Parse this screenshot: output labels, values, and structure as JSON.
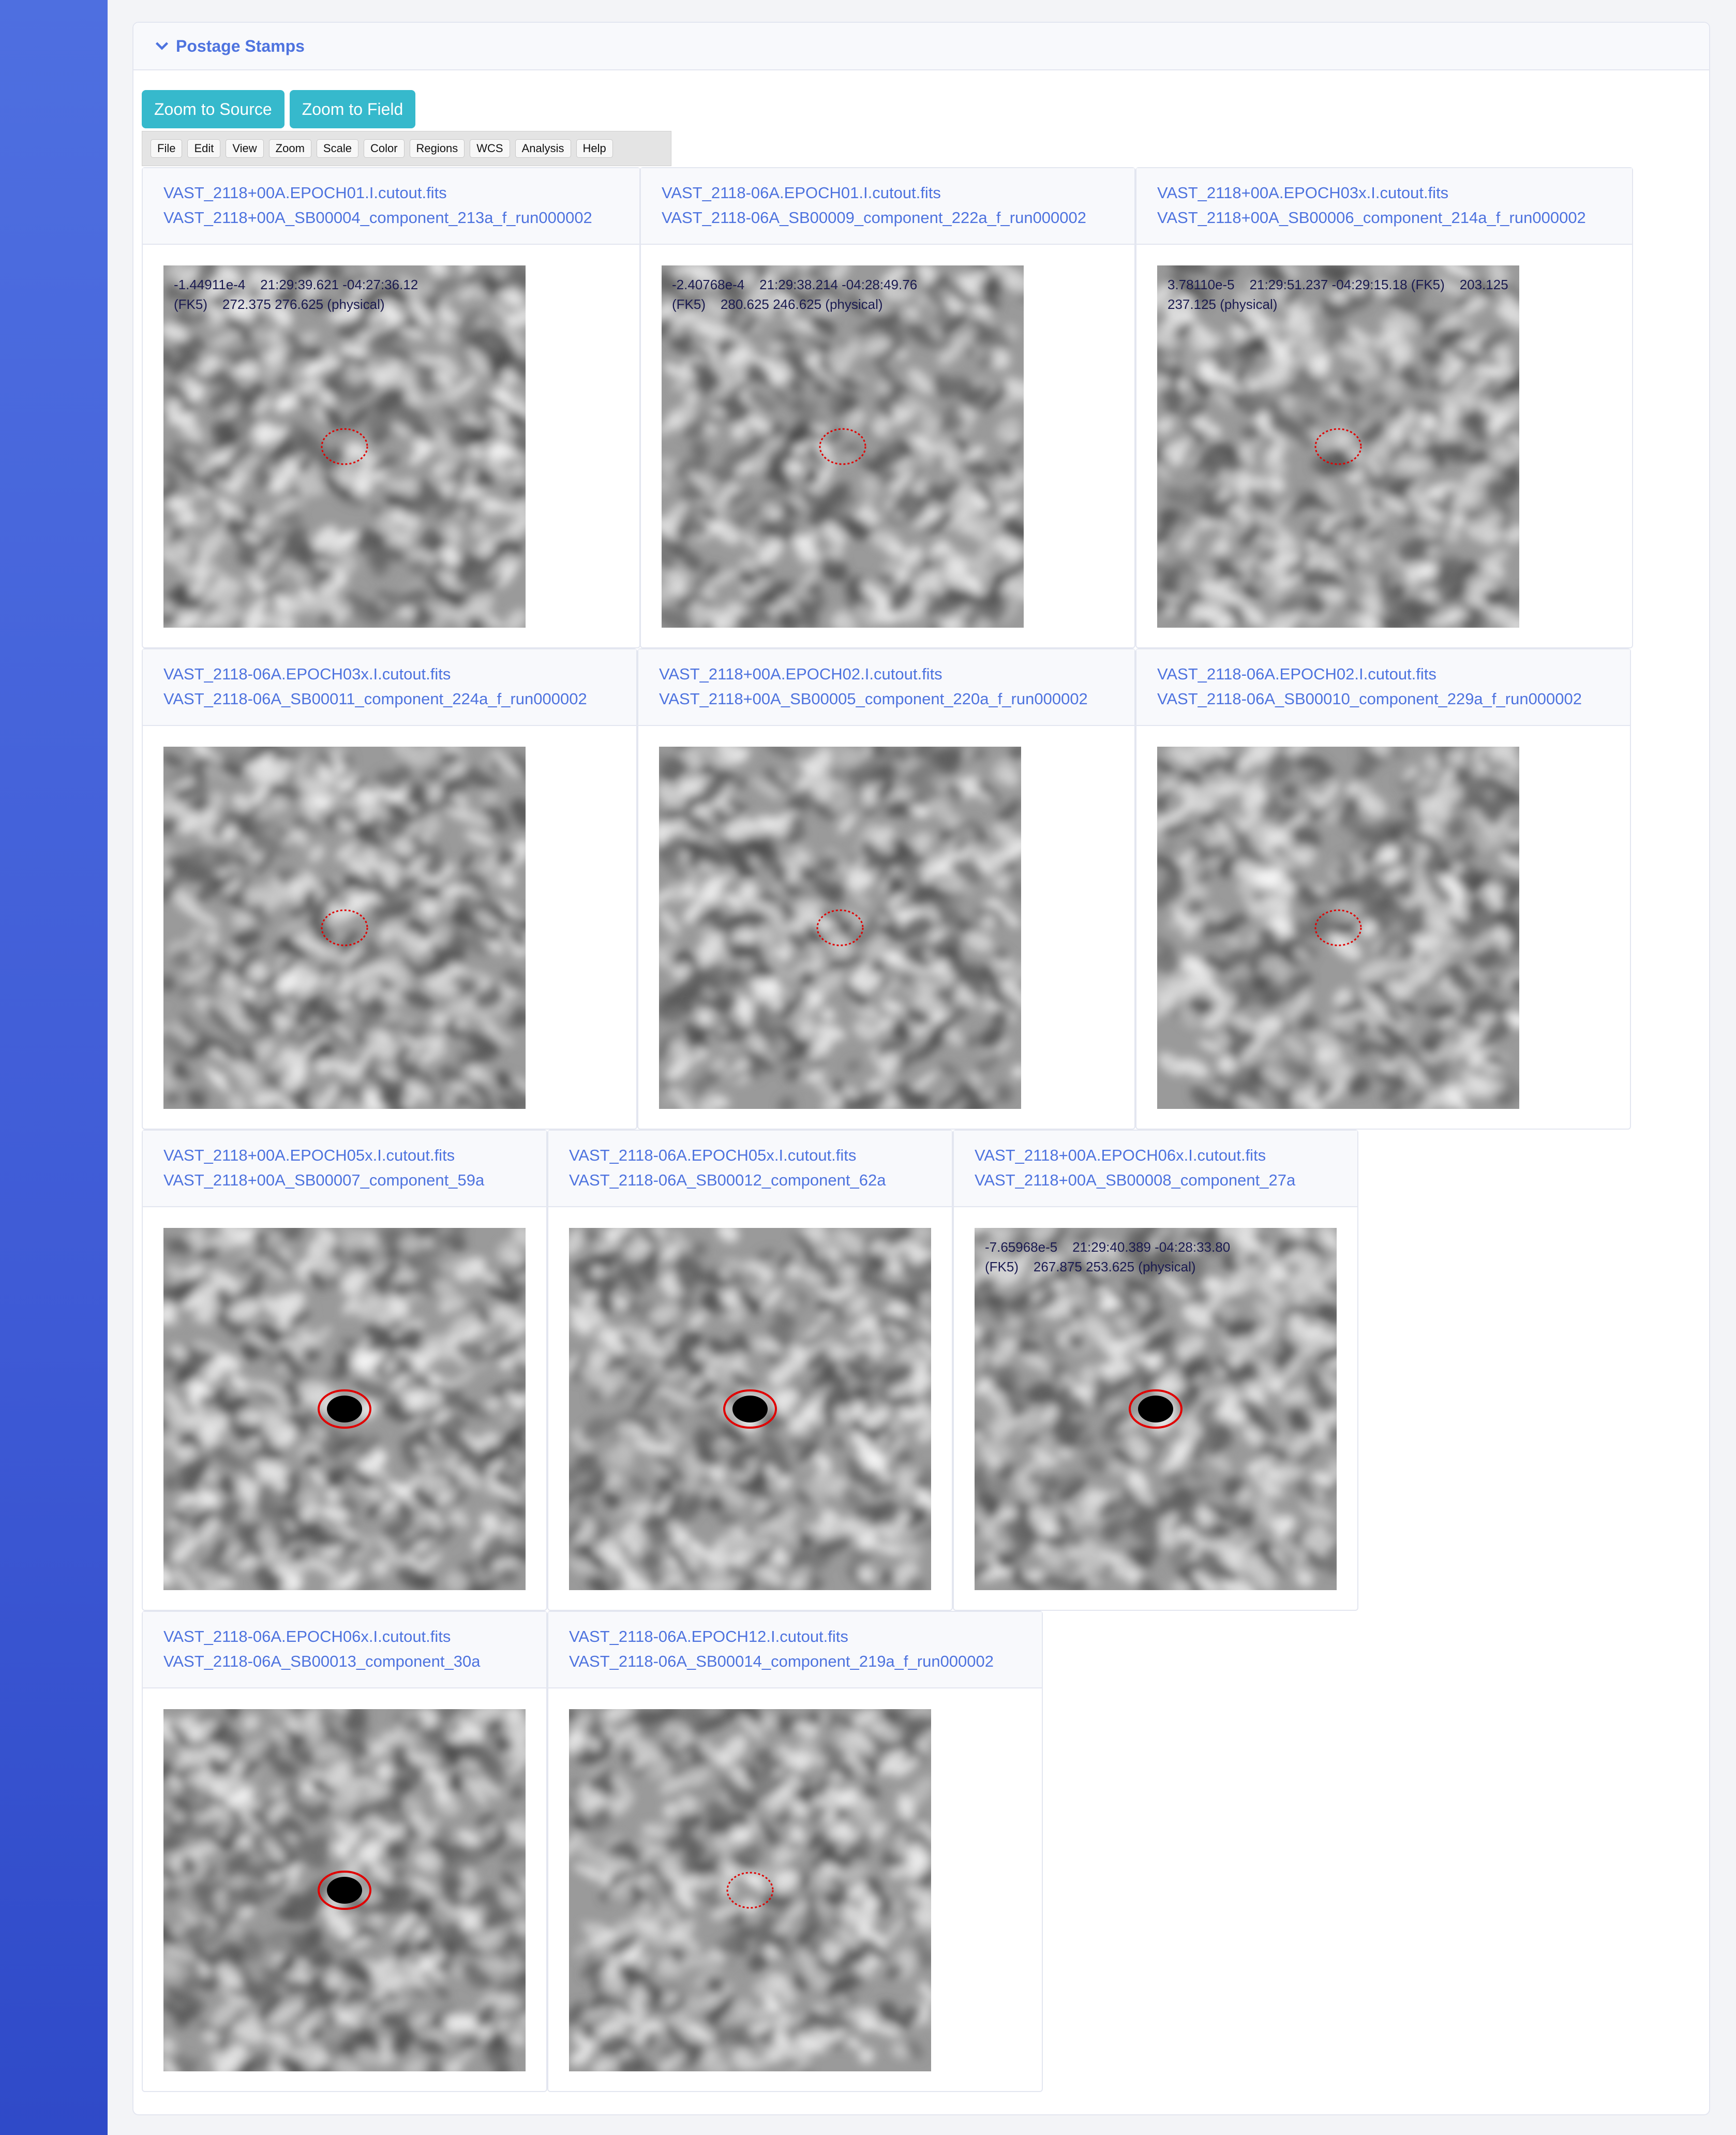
{
  "panel": {
    "title": "Postage Stamps"
  },
  "buttons": {
    "zoom_source": "Zoom to Source",
    "zoom_field": "Zoom to Field"
  },
  "menu": [
    "File",
    "Edit",
    "View",
    "Zoom",
    "Scale",
    "Color",
    "Regions",
    "WCS",
    "Analysis",
    "Help"
  ],
  "stamps": [
    {
      "file": "VAST_2118+00A.EPOCH01.I.cutout.fits",
      "component": "VAST_2118+00A_SB00004_component_213a_f_run000002",
      "readout_line1": "-1.44911e-4    21:29:39.621 -04:27:36.12",
      "readout_line2": "(FK5)    272.375 276.625 (physical)",
      "source": "faint",
      "ellipse_style": "dotted"
    },
    {
      "file": "VAST_2118-06A.EPOCH01.I.cutout.fits",
      "component": "VAST_2118-06A_SB00009_component_222a_f_run000002",
      "readout_line1": "-2.40768e-4    21:29:38.214 -04:28:49.76",
      "readout_line2": "(FK5)    280.625 246.625 (physical)",
      "source": "faint",
      "ellipse_style": "dotted"
    },
    {
      "file": "VAST_2118+00A.EPOCH03x.I.cutout.fits",
      "component": "VAST_2118+00A_SB00006_component_214a_f_run000002",
      "readout_line1": "3.78110e-5    21:29:51.237 -04:29:15.18 (FK5)    203.125",
      "readout_line2": "237.125 (physical)",
      "source": "faint",
      "ellipse_style": "dotted"
    },
    {
      "file": "VAST_2118-06A.EPOCH03x.I.cutout.fits",
      "component": "VAST_2118-06A_SB00011_component_224a_f_run000002",
      "readout_line1": "",
      "readout_line2": "",
      "source": "faint",
      "ellipse_style": "dotted"
    },
    {
      "file": "VAST_2118+00A.EPOCH02.I.cutout.fits",
      "component": "VAST_2118+00A_SB00005_component_220a_f_run000002",
      "readout_line1": "",
      "readout_line2": "",
      "source": "faint",
      "ellipse_style": "dotted"
    },
    {
      "file": "VAST_2118-06A.EPOCH02.I.cutout.fits",
      "component": "VAST_2118-06A_SB00010_component_229a_f_run000002",
      "readout_line1": "",
      "readout_line2": "",
      "source": "faint",
      "ellipse_style": "dotted"
    },
    {
      "file": "VAST_2118+00A.EPOCH05x.I.cutout.fits",
      "component": "VAST_2118+00A_SB00007_component_59a",
      "readout_line1": "",
      "readout_line2": "",
      "source": "bright",
      "ellipse_style": "solid"
    },
    {
      "file": "VAST_2118-06A.EPOCH05x.I.cutout.fits",
      "component": "VAST_2118-06A_SB00012_component_62a",
      "readout_line1": "",
      "readout_line2": "",
      "source": "bright",
      "ellipse_style": "solid"
    },
    {
      "file": "VAST_2118+00A.EPOCH06x.I.cutout.fits",
      "component": "VAST_2118+00A_SB00008_component_27a",
      "readout_line1": "-7.65968e-5    21:29:40.389 -04:28:33.80",
      "readout_line2": "(FK5)    267.875 253.625 (physical)",
      "source": "bright",
      "ellipse_style": "solid"
    },
    {
      "file": "VAST_2118-06A.EPOCH06x.I.cutout.fits",
      "component": "VAST_2118-06A_SB00013_component_30a",
      "readout_line1": "",
      "readout_line2": "",
      "source": "bright",
      "ellipse_style": "solid"
    },
    {
      "file": "VAST_2118-06A.EPOCH12.I.cutout.fits",
      "component": "VAST_2118-06A_SB00014_component_219a_f_run000002",
      "readout_line1": "",
      "readout_line2": "",
      "source": "faint",
      "ellipse_style": "dotted"
    }
  ]
}
